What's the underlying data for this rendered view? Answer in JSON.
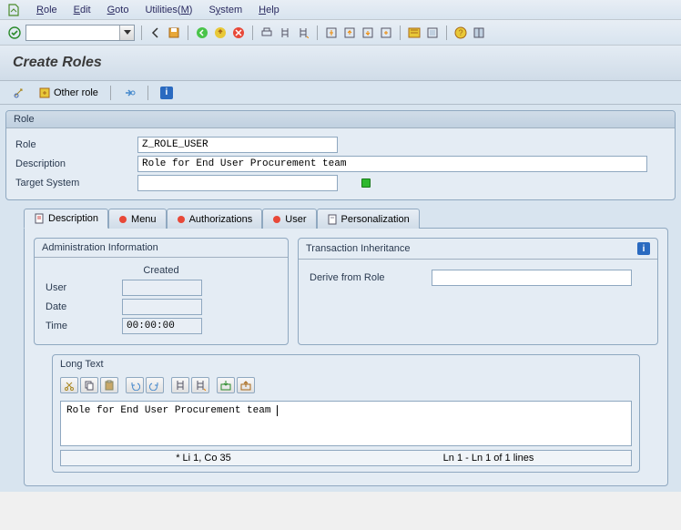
{
  "menubar": [
    "Role",
    "Edit",
    "Goto",
    "Utilities(M)",
    "System",
    "Help"
  ],
  "title": "Create Roles",
  "subToolbar": {
    "otherRole": "Other role"
  },
  "rolePanel": {
    "header": "Role",
    "roleLabel": "Role",
    "roleValue": "Z_ROLE_USER",
    "descLabel": "Description",
    "descValue": "Role for End User Procurement team",
    "targetLabel": "Target System",
    "targetValue": ""
  },
  "tabs": [
    "Description",
    "Menu",
    "Authorizations",
    "User",
    "Personalization"
  ],
  "admin": {
    "header": "Administration Information",
    "createdHeader": "Created",
    "userLabel": "User",
    "userValue": "",
    "dateLabel": "Date",
    "dateValue": "",
    "timeLabel": "Time",
    "timeValue": "00:00:00"
  },
  "inherit": {
    "header": "Transaction Inheritance",
    "deriveLabel": "Derive from Role",
    "deriveValue": ""
  },
  "longText": {
    "header": "Long Text",
    "text": "Role for End User Procurement team",
    "statusLeft": "* Li 1, Co 35",
    "statusRight": "Ln 1 - Ln 1 of 1 lines"
  }
}
